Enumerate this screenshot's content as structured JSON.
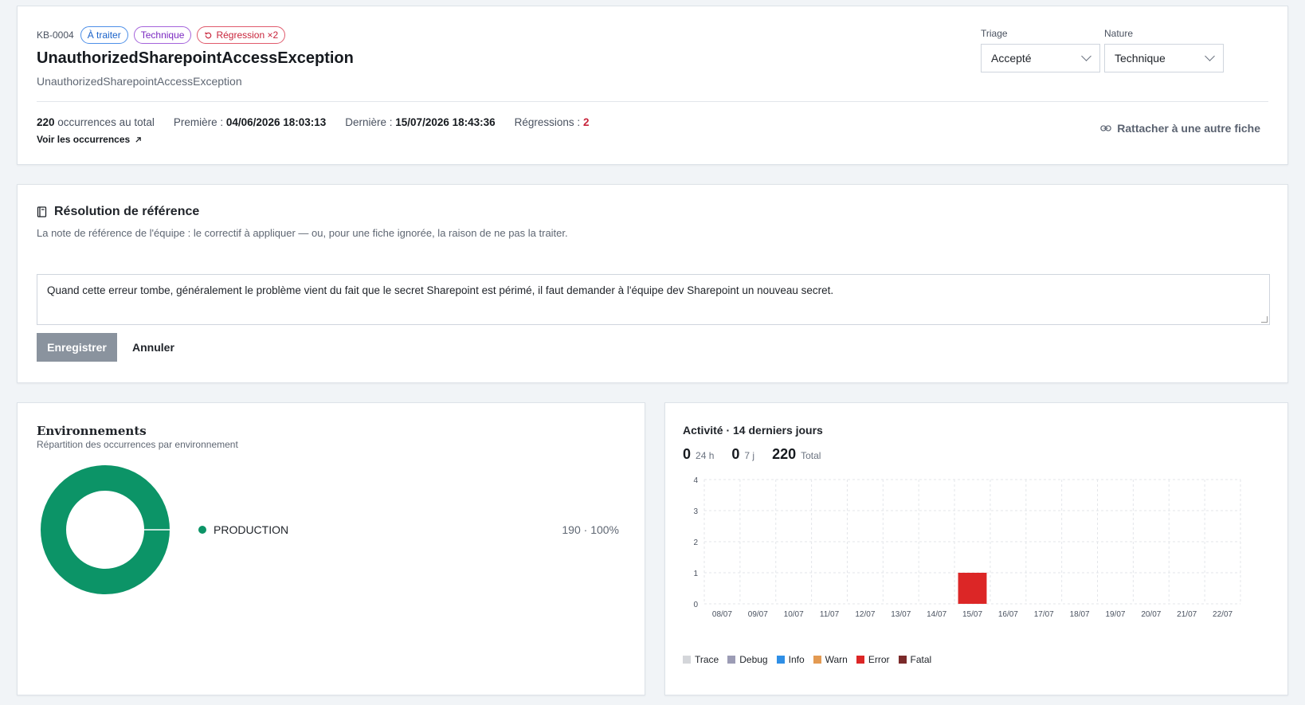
{
  "header": {
    "kb_id": "KB-0004",
    "tags": [
      {
        "label": "À traiter",
        "color": "#1a62c9"
      },
      {
        "label": "Technique",
        "color": "#7b2ac1"
      },
      {
        "label": "Régression ×2",
        "color": "#c8243b"
      }
    ],
    "title": "UnauthorizedSharepointAccessException",
    "subtitle": "UnauthorizedSharepointAccessException",
    "triage": {
      "label": "Triage",
      "value": "Accepté"
    },
    "nature": {
      "label": "Nature",
      "value": "Technique"
    },
    "stats": {
      "total_value": "220",
      "total_suffix": " occurrences au total",
      "first_label": "Première : ",
      "first_value": "04/06/2026 18:03:13",
      "last_label": "Dernière : ",
      "last_value": "15/07/2026 18:43:36",
      "regressions_label": "Régressions : ",
      "regressions_value": "2"
    },
    "voir_link": "Voir les occurrences",
    "rattacher_link": "Rattacher à une autre fiche"
  },
  "resolution": {
    "title": "Résolution de référence",
    "description": "La note de référence de l'équipe : le correctif à appliquer — ou, pour une fiche ignorée, la raison de ne pas la traiter.",
    "note": "Quand cette erreur tombe, généralement le problème vient du fait que le secret Sharepoint est périmé, il faut demander à l'équipe dev Sharepoint un nouveau secret.",
    "save_label": "Enregistrer",
    "cancel_label": "Annuler"
  },
  "environments": {
    "title": "Environnements",
    "subtitle": "Répartition des occurrences par environnement",
    "items": [
      {
        "name": "PRODUCTION",
        "value": "190 · 100%",
        "color": "#0c9467",
        "share": 1.0
      }
    ]
  },
  "activity": {
    "title": "Activité · 14 derniers jours",
    "counters": [
      {
        "value": "0",
        "label": "24 h"
      },
      {
        "value": "0",
        "label": "7 j"
      },
      {
        "value": "220",
        "label": "Total"
      }
    ]
  },
  "chart_data": {
    "type": "bar",
    "categories": [
      "08/07",
      "09/07",
      "10/07",
      "11/07",
      "12/07",
      "13/07",
      "14/07",
      "15/07",
      "16/07",
      "17/07",
      "18/07",
      "19/07",
      "20/07",
      "21/07",
      "22/07"
    ],
    "series": [
      {
        "name": "Trace",
        "color": "#d4d6da",
        "values": [
          0,
          0,
          0,
          0,
          0,
          0,
          0,
          0,
          0,
          0,
          0,
          0,
          0,
          0,
          0
        ]
      },
      {
        "name": "Debug",
        "color": "#9c9cb5",
        "values": [
          0,
          0,
          0,
          0,
          0,
          0,
          0,
          0,
          0,
          0,
          0,
          0,
          0,
          0,
          0
        ]
      },
      {
        "name": "Info",
        "color": "#2f8fe6",
        "values": [
          0,
          0,
          0,
          0,
          0,
          0,
          0,
          0,
          0,
          0,
          0,
          0,
          0,
          0,
          0
        ]
      },
      {
        "name": "Warn",
        "color": "#e39a52",
        "values": [
          0,
          0,
          0,
          0,
          0,
          0,
          0,
          0,
          0,
          0,
          0,
          0,
          0,
          0,
          0
        ]
      },
      {
        "name": "Error",
        "color": "#dc2626",
        "values": [
          0,
          0,
          0,
          0,
          0,
          0,
          0,
          1,
          0,
          0,
          0,
          0,
          0,
          0,
          0
        ]
      },
      {
        "name": "Fatal",
        "color": "#7b2a2a",
        "values": [
          0,
          0,
          0,
          0,
          0,
          0,
          0,
          0,
          0,
          0,
          0,
          0,
          0,
          0,
          0
        ]
      }
    ],
    "yticks": [
      "0",
      "1",
      "2",
      "3",
      "4"
    ],
    "ylim": [
      0,
      4
    ],
    "stacked": true,
    "grid": true,
    "legend": "bottom"
  }
}
